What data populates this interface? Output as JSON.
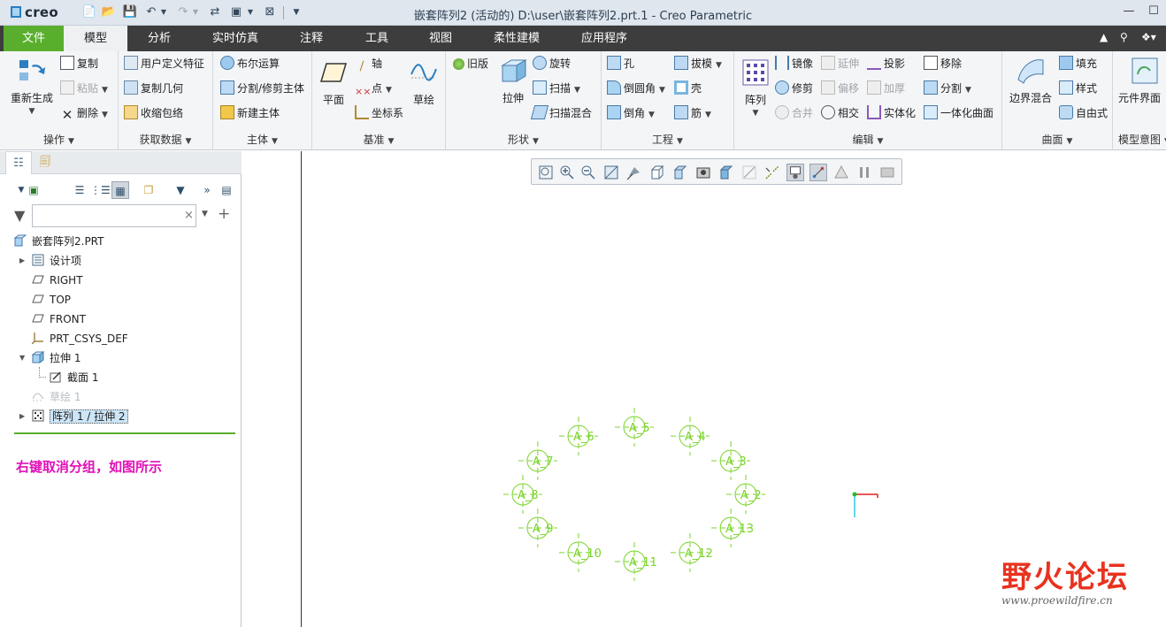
{
  "app": {
    "logo": "creo",
    "window_title": "嵌套阵列2 (活动的) D:\\user\\嵌套阵列2.prt.1 - Creo Parametric"
  },
  "tabs": [
    "文件",
    "模型",
    "分析",
    "实时仿真",
    "注释",
    "工具",
    "视图",
    "柔性建模",
    "应用程序"
  ],
  "active_tab": "模型",
  "ribbon": {
    "ops": {
      "regen": "重新生成",
      "copy": "复制",
      "paste": "粘贴",
      "delete": "删除",
      "group": "操作"
    },
    "getdata": {
      "udf": "用户定义特征",
      "copygeom": "复制几何",
      "shrink": "收缩包络",
      "group": "获取数据"
    },
    "body": {
      "bool": "布尔运算",
      "split": "分割/修剪主体",
      "newbody": "新建主体",
      "group": "主体"
    },
    "datum": {
      "plane": "平面",
      "axis": "轴",
      "point": "点",
      "csys": "坐标系",
      "sketch": "草绘",
      "group": "基准"
    },
    "shape": {
      "legacy": "旧版",
      "extrude": "拉伸",
      "revolve": "旋转",
      "sweep": "扫描",
      "swept_blend": "扫描混合",
      "group": "形状"
    },
    "eng": {
      "hole": "孔",
      "round": "倒圆角",
      "chamfer": "倒角",
      "draft": "拔模",
      "shell": "壳",
      "rib": "筋",
      "group": "工程"
    },
    "edit": {
      "pattern": "阵列",
      "mirror": "镜像",
      "trim": "修剪",
      "merge": "合并",
      "extend": "延伸",
      "offset": "偏移",
      "intersect": "相交",
      "project": "投影",
      "thicken": "加厚",
      "solidify": "实体化",
      "remove": "移除",
      "split": "分割",
      "unify": "一体化曲面",
      "group": "编辑"
    },
    "surface": {
      "boundary": "边界混合",
      "fill": "填充",
      "style": "样式",
      "freestyle": "自由式",
      "group": "曲面"
    },
    "intent": {
      "component": "元件界面",
      "group": "模型意图"
    }
  },
  "model_tree": {
    "filter_placeholder": "",
    "root": "嵌套阵列2.PRT",
    "items": [
      {
        "label": "设计项",
        "icon": "design-items-icon"
      },
      {
        "label": "RIGHT",
        "icon": "datum-plane-icon"
      },
      {
        "label": "TOP",
        "icon": "datum-plane-icon"
      },
      {
        "label": "FRONT",
        "icon": "datum-plane-icon"
      },
      {
        "label": "PRT_CSYS_DEF",
        "icon": "csys-icon"
      },
      {
        "label": "拉伸 1",
        "icon": "extrude-icon"
      },
      {
        "label": "截面 1",
        "icon": "section-icon"
      },
      {
        "label": "草绘 1",
        "icon": "sketch-icon"
      },
      {
        "label": "阵列 1 / 拉伸 2",
        "icon": "pattern-icon"
      }
    ],
    "annotation": "右键取消分组，如图所示"
  },
  "viewport": {
    "axis_labels": [
      "A_2",
      "A_3",
      "A_4",
      "A_5",
      "A_6",
      "A_7",
      "A_8",
      "A_9",
      "A_10",
      "A_11",
      "A_12",
      "A_13"
    ],
    "colors": {
      "axis": "#7ad42a",
      "csys_x": "#e02020",
      "csys_y": "#30c8e0",
      "origin": "#20c020"
    }
  },
  "watermark": {
    "main": "野火论坛",
    "sub": "www.proewildfire.cn"
  }
}
